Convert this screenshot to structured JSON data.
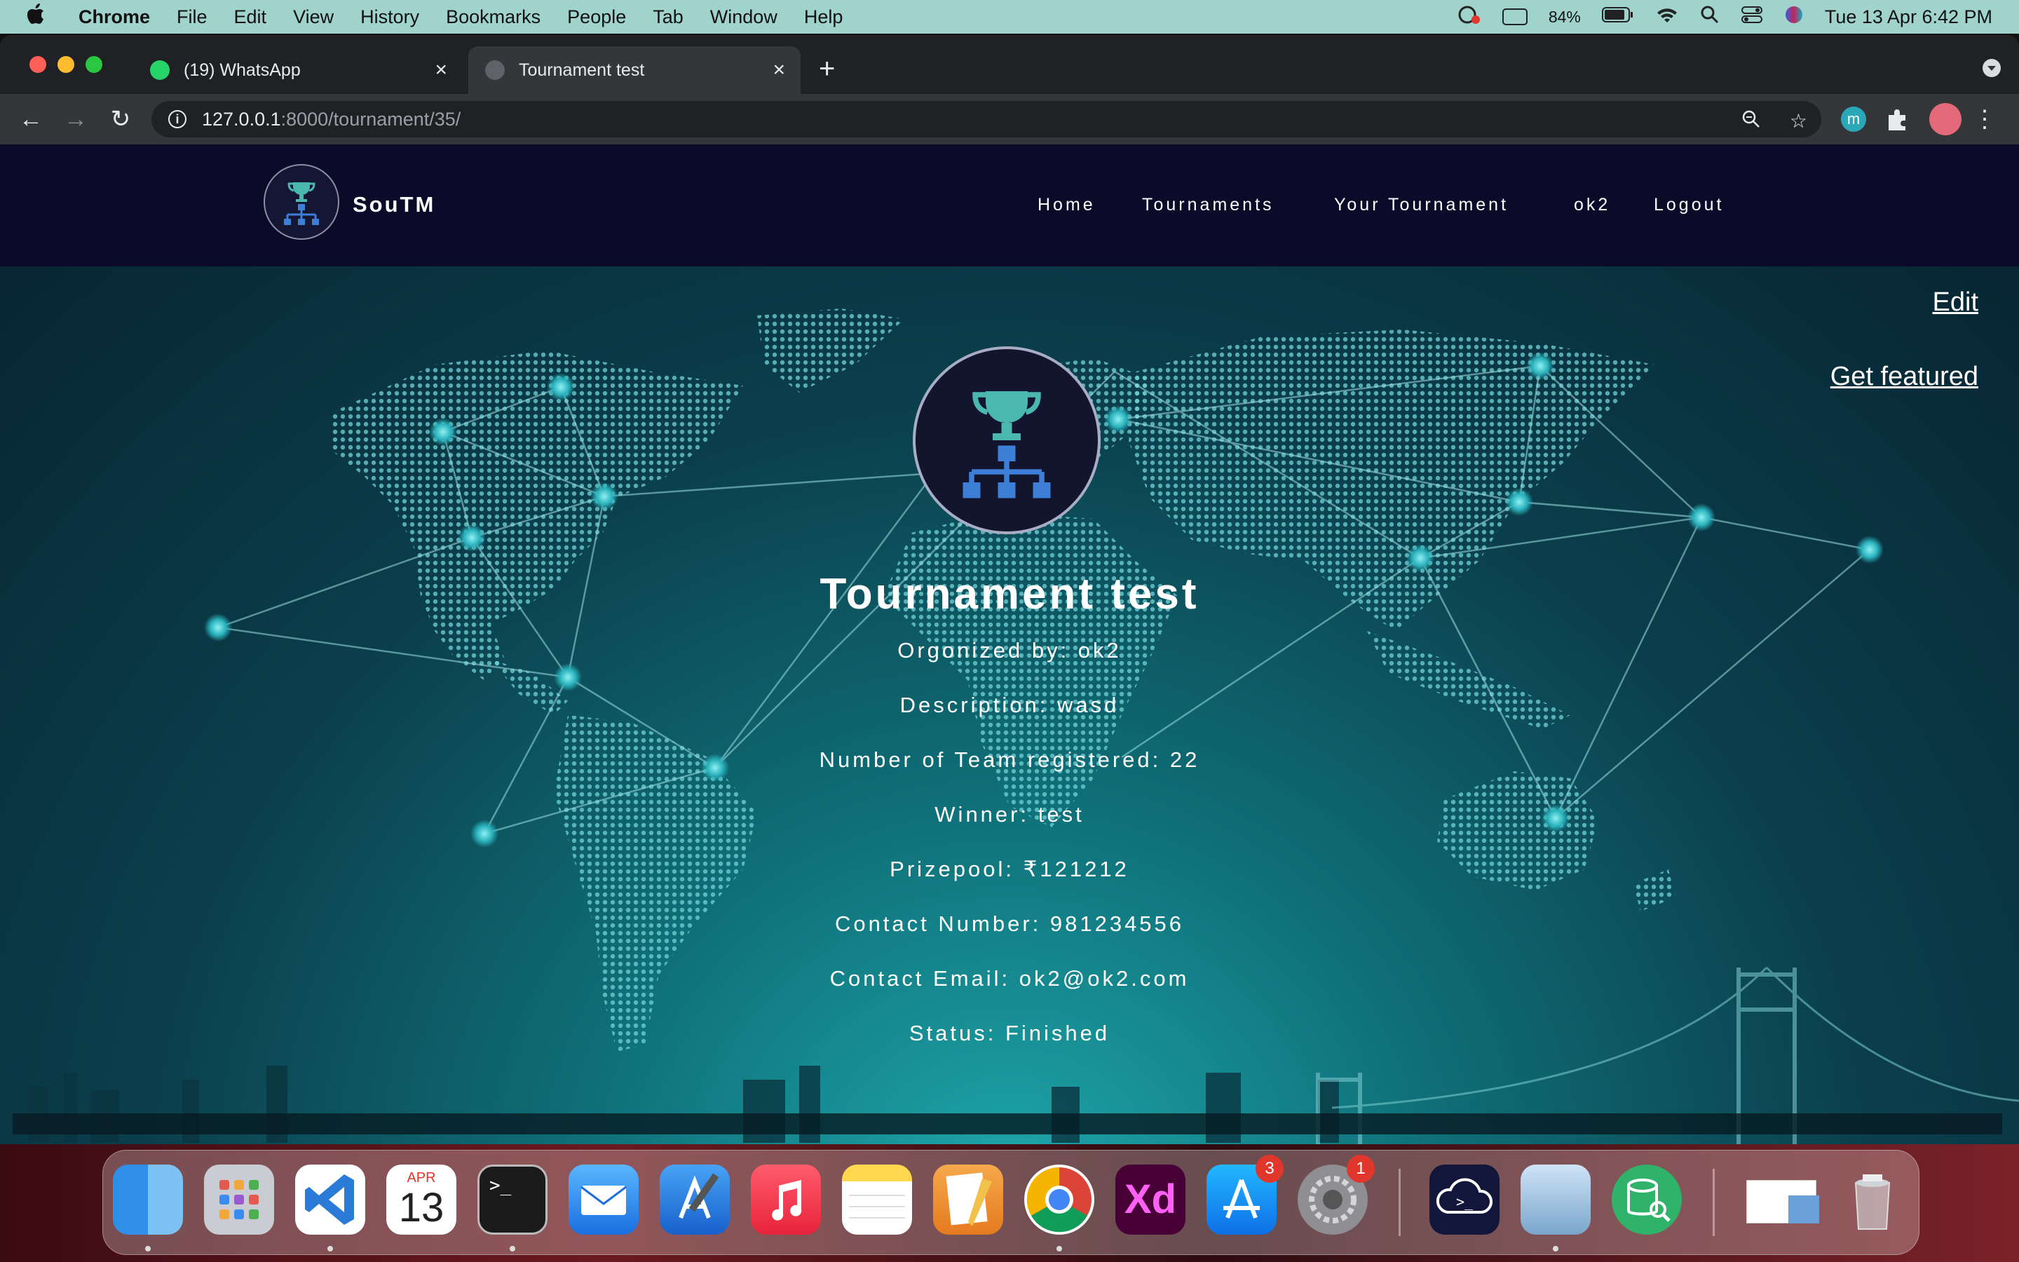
{
  "menubar": {
    "apple": "",
    "app": "Chrome",
    "items": [
      "File",
      "Edit",
      "View",
      "History",
      "Bookmarks",
      "People",
      "Tab",
      "Window",
      "Help"
    ],
    "battery": "84%",
    "datetime": "Tue 13 Apr  6:42 PM"
  },
  "browser": {
    "tabs": [
      {
        "title": "(19) WhatsApp",
        "favicon_color": "#25d366",
        "badge": "19"
      },
      {
        "title": "Tournament test",
        "favicon_color": "#5f6368"
      }
    ],
    "url_host": "127.0.0.1",
    "url_rest": ":8000/tournament/35/",
    "profile_initial": "m"
  },
  "site": {
    "brand": "SouTM",
    "nav": [
      "Home",
      "Tournaments",
      "Your Tournament",
      "ok2",
      "Logout"
    ],
    "edit": "Edit",
    "get_featured": "Get featured",
    "tournament": {
      "title": "Tournament test",
      "organized_by": "Orgonized by: ok2",
      "description": "Description: wasd",
      "teams": "Number of Team registered: 22",
      "winner": "Winner: test",
      "prizepool": "Prizepool: ₹121212",
      "contact_number": "Contact Number: 981234556",
      "contact_email": "Contact Email: ok2@ok2.com",
      "status": "Status: Finished"
    }
  },
  "dock": {
    "calendar_month": "APR",
    "calendar_day": "13",
    "appstore_badge": "3",
    "settings_badge": "1",
    "xd_label": "Xd"
  },
  "colors": {
    "nav_bg": "#0b0b29",
    "hero_teal": "#0f6f78",
    "logo_trophy": "#4bb8b0",
    "logo_bracket": "#3d7fd6"
  }
}
